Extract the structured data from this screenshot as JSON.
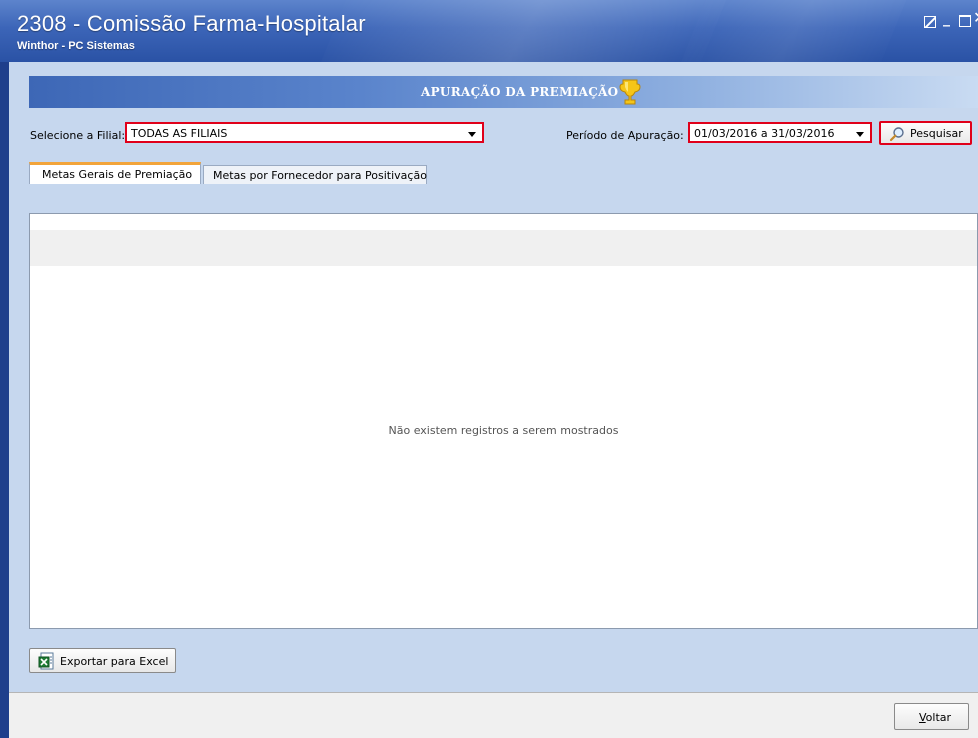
{
  "window": {
    "title": "2308 - Comissão Farma-Hospitalar",
    "subtitle": "Winthor - PC Sistemas",
    "controls": [
      "restore-icon",
      "minimize-icon",
      "maximize-icon",
      "close-icon"
    ]
  },
  "banner": {
    "title": "APURAÇÃO DA PREMIAÇÃO",
    "icon": "trophy-icon"
  },
  "filters": {
    "filial_label": "Selecione a Filial:",
    "filial_value": "TODAS AS FILIAIS",
    "periodo_label": "Período de Apuração:",
    "periodo_value": "01/03/2016 a 31/03/2016",
    "search_button": "Pesquisar",
    "search_icon": "magnifier-icon"
  },
  "tabs": [
    {
      "label": "Metas Gerais de Premiação",
      "active": true
    },
    {
      "label": "Metas por Fornecedor para Positivação",
      "active": false
    }
  ],
  "grid": {
    "empty_message": "Não existem registros a serem mostrados"
  },
  "actions": {
    "export_button": "Exportar para Excel",
    "export_icon": "excel-icon",
    "back_button_prefix": "V",
    "back_button_rest": "oltar"
  },
  "colors": {
    "highlight": "#e0001a",
    "title_bar": "#3c65b8",
    "client_bg": "#c6d7ee",
    "active_tab_accent": "#f2a43a"
  }
}
